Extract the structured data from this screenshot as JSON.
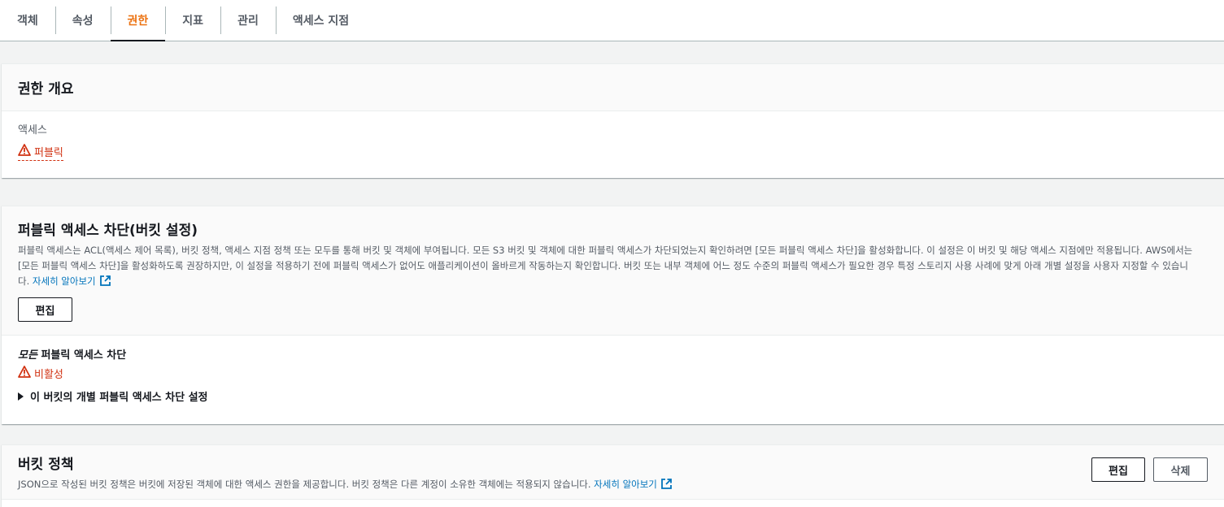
{
  "tabs": [
    {
      "label": "객체"
    },
    {
      "label": "속성"
    },
    {
      "label": "권한"
    },
    {
      "label": "지표"
    },
    {
      "label": "관리"
    },
    {
      "label": "액세스 지점"
    }
  ],
  "overview": {
    "title": "권한 개요",
    "access_label": "액세스",
    "access_value": "퍼블릭"
  },
  "block_public": {
    "title": "퍼블릭 액세스 차단(버킷 설정)",
    "description": "퍼블릭 액세스는 ACL(액세스 제어 목록), 버킷 정책, 액세스 지점 정책 또는 모두를 통해 버킷 및 객체에 부여됩니다. 모든 S3 버킷 및 객체에 대한 퍼블릭 액세스가 차단되었는지 확인하려면 [모든 퍼블릭 액세스 차단]을 활성화합니다. 이 설정은 이 버킷 및 해당 액세스 지점에만 적용됩니다. AWS에서는 [모든 퍼블릭 액세스 차단]을 활성화하도록 권장하지만, 이 설정을 적용하기 전에 퍼블릭 액세스가 없어도 애플리케이션이 올바르게 작동하는지 확인합니다. 버킷 또는 내부 객체에 어느 정도 수준의 퍼블릭 액세스가 필요한 경우 특정 스토리지 사용 사례에 맞게 아래 개별 설정을 사용자 지정할 수 있습니다.",
    "learn_more": "자세히 알아보기",
    "edit_label": "편집",
    "setting_label_italic": "모든",
    "setting_label_rest": " 퍼블릭 액세스 차단",
    "setting_value": "비활성",
    "expand_label": "이 버킷의 개별 퍼블릭 액세스 차단 설정"
  },
  "bucket_policy": {
    "title": "버킷 정책",
    "description": "JSON으로 작성된 버킷 정책은 버킷에 저장된 객체에 대한 액세스 권한을 제공합니다. 버킷 정책은 다른 계정이 소유한 객체에는 적용되지 않습니다.",
    "learn_more": "자세히 알아보기",
    "edit_label": "편집",
    "delete_label": "삭제"
  },
  "colors": {
    "accent": "#ec7211",
    "warning": "#d13212",
    "link": "#0073bb"
  },
  "icons": [
    "warning-icon",
    "external-link-icon",
    "caret-right-icon"
  ]
}
